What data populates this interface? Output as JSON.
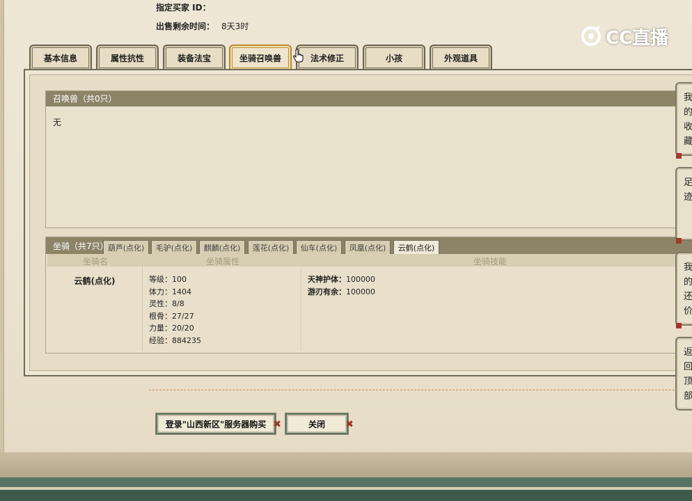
{
  "header": {
    "buyer_id_label": "指定买家 ID：",
    "time_label": "出售剩余时间：",
    "time_value": "8天3时"
  },
  "logo": {
    "text": "CC直播"
  },
  "tabs": [
    {
      "label": "基本信息"
    },
    {
      "label": "属性抗性"
    },
    {
      "label": "装备法宝"
    },
    {
      "label": "坐骑召唤兽",
      "active": true
    },
    {
      "label": "法术修正"
    },
    {
      "label": "小孩"
    },
    {
      "label": "外观道具"
    }
  ],
  "summon": {
    "title": "召唤兽（共0只）",
    "empty_text": "无"
  },
  "mount": {
    "title": "坐骑（共7只）",
    "subtabs": [
      {
        "label": "葫芦(点化)"
      },
      {
        "label": "毛驴(点化)"
      },
      {
        "label": "麒麟(点化)"
      },
      {
        "label": "莲花(点化)"
      },
      {
        "label": "仙车(点化)"
      },
      {
        "label": "凤凰(点化)"
      },
      {
        "label": "云鹤(点化)",
        "active": true
      }
    ],
    "columns": {
      "name": "坐骑名",
      "attr": "坐骑属性",
      "skill": "坐骑技能"
    },
    "name": "云鹤(点化)",
    "attrs": [
      {
        "label": "等级：",
        "value": "100"
      },
      {
        "label": "体力：",
        "value": "1404"
      },
      {
        "label": "灵性：",
        "value": "8/8"
      },
      {
        "label": "根骨：",
        "value": "27/27"
      },
      {
        "label": "力量：",
        "value": "20/20"
      },
      {
        "label": "经验：",
        "value": "884235"
      }
    ],
    "skills": [
      {
        "label": "天神护体：",
        "value": "100000"
      },
      {
        "label": "游刃有余：",
        "value": "100000"
      }
    ]
  },
  "buttons": {
    "login_buy": "登录\"山西新区\"服务器购买",
    "close": "关闭"
  },
  "side_tabs": [
    {
      "label": "我的收藏"
    },
    {
      "label": "足迹"
    },
    {
      "label": "我的还价"
    },
    {
      "label": "返回顶部"
    }
  ]
}
